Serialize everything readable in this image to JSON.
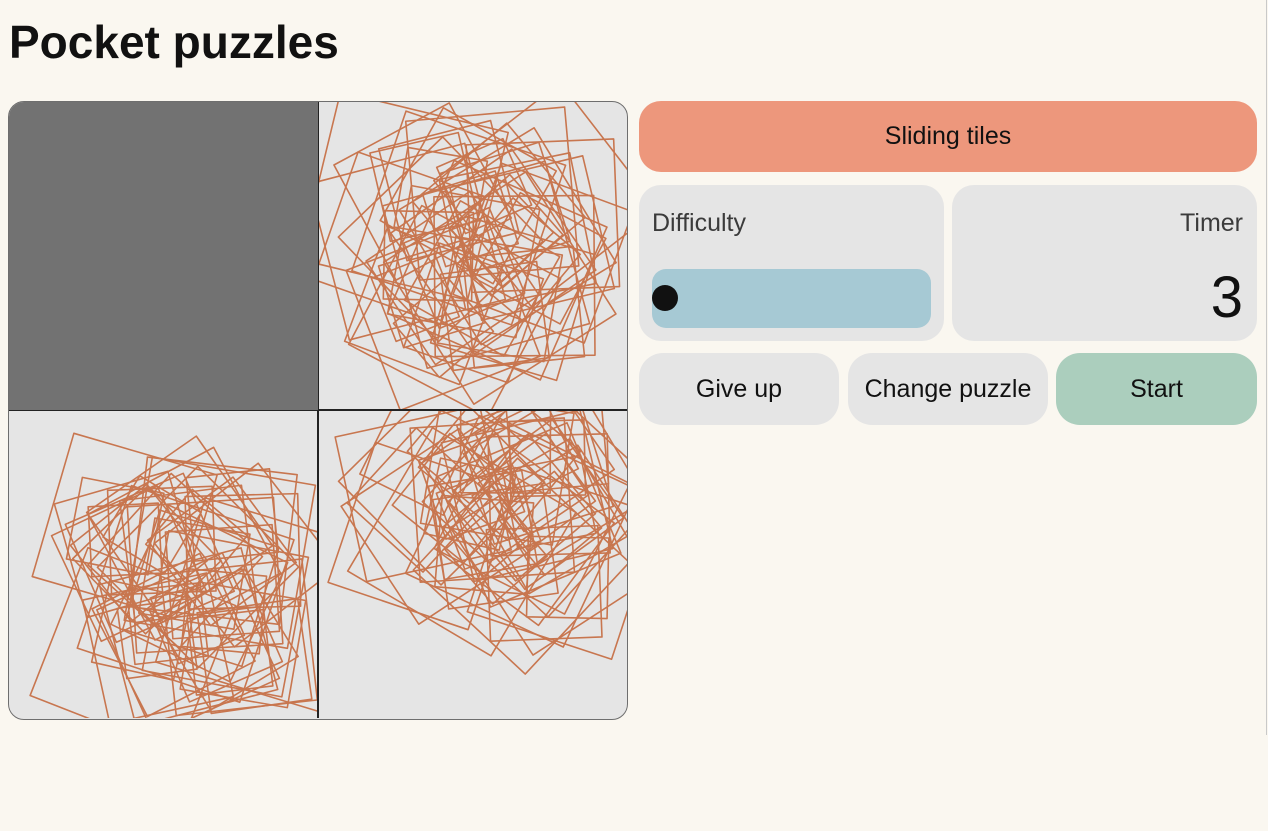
{
  "page": {
    "title": "Pocket puzzles"
  },
  "puzzle_board": {
    "grid": "2x2",
    "empty_slot": "top-left",
    "tiles": [
      "blank",
      "star-pattern-fragment",
      "star-pattern-fragment",
      "star-pattern-fragment"
    ],
    "pattern_color": "#c8764f",
    "tile_background": "#e5e5e5",
    "blank_color": "#727272"
  },
  "controls": {
    "mode_button_label": "Sliding tiles",
    "difficulty_label": "Difficulty",
    "difficulty_level": 0,
    "timer_label": "Timer",
    "timer_value": "3",
    "give_up_label": "Give up",
    "change_puzzle_label": "Change puzzle",
    "start_label": "Start"
  },
  "colors": {
    "background": "#faf7f0",
    "mode_button": "#ed977c",
    "slider_track": "#a6c9d4",
    "start_button": "#abcebd",
    "neutral_button": "#e5e5e5"
  }
}
